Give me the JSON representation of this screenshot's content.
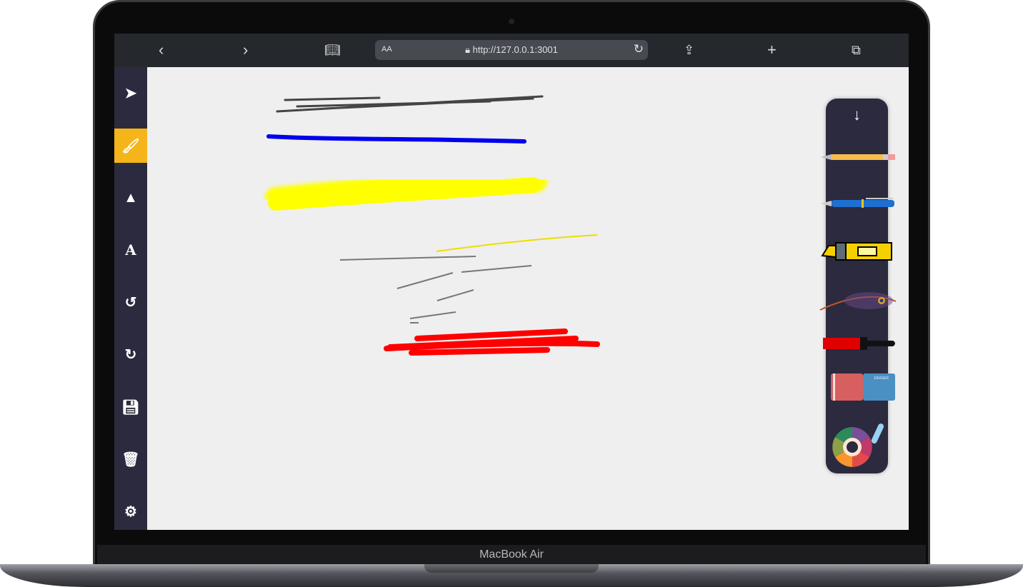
{
  "device": {
    "label": "MacBook Air"
  },
  "browser": {
    "text_size": "AA",
    "url": "http://127.0.0.1:3001"
  },
  "sidebar": {
    "tools": [
      {
        "name": "select",
        "icon": "cursor-icon"
      },
      {
        "name": "brush",
        "icon": "brush-icon",
        "active": true
      },
      {
        "name": "shapes",
        "icon": "shapes-icon"
      },
      {
        "name": "text",
        "icon": "text-icon",
        "glyph": "A"
      },
      {
        "name": "undo",
        "icon": "undo-icon"
      },
      {
        "name": "redo",
        "icon": "redo-icon"
      },
      {
        "name": "save",
        "icon": "save-icon"
      },
      {
        "name": "delete",
        "icon": "trash-icon"
      },
      {
        "name": "settings",
        "icon": "gear-icon"
      }
    ]
  },
  "brush_panel": {
    "items": [
      "pencil",
      "pen",
      "highlighter",
      "feather",
      "paintbrush",
      "eraser",
      "color-picker"
    ],
    "eraser_text": "ERASER"
  },
  "colors": {
    "accent": "#f5b51a",
    "sidebar": "#2b2a3e",
    "strokes": [
      "#444444",
      "#0000ee",
      "#ffff00",
      "#666666",
      "#ff0000"
    ]
  }
}
